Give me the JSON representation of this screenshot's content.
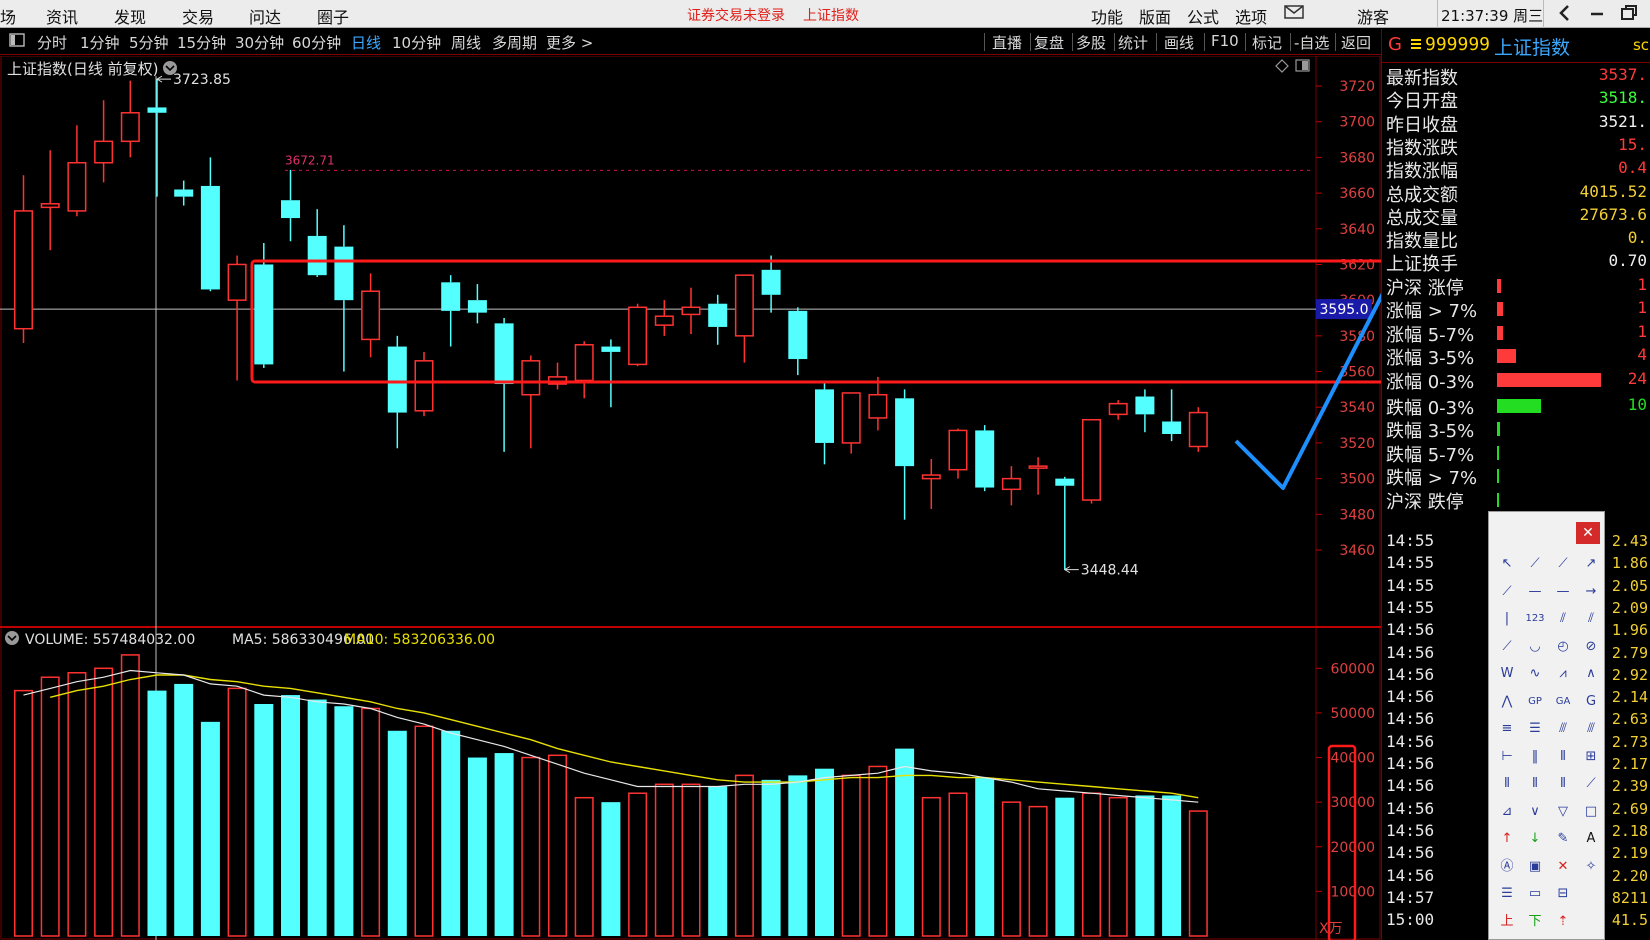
{
  "menubar": {
    "items": [
      "场",
      "资讯",
      "发现",
      "交易",
      "问达",
      "圈子"
    ],
    "warning": "证券交易未登录",
    "index_name": "上证指数",
    "right_items": [
      "功能",
      "版面",
      "公式",
      "选项"
    ],
    "mail_icon": "mail-icon",
    "guest": "游客",
    "clock": "21:37:39 周三",
    "window_buttons": [
      "back-icon",
      "minimize-icon",
      "restore-icon"
    ]
  },
  "periodbar": {
    "periods": [
      "分时",
      "1分钟",
      "5分钟",
      "15分钟",
      "30分钟",
      "60分钟",
      "日线",
      "10分钟",
      "周线",
      "多周期",
      "更多 >"
    ],
    "active": "日线",
    "tools": [
      "直播",
      "复盘",
      "多股",
      "统计",
      "画线",
      "F10",
      "标记",
      "-自选",
      "返回"
    ]
  },
  "chart_title": "上证指数(日线 前复权)",
  "volume_header": {
    "volume": "VOLUME: 557484032.00",
    "ma5": "MA5: 586330496.00",
    "ma10": "MA10: 583206336.00"
  },
  "colors": {
    "up": "#ff3232",
    "down": "#54ffff",
    "ma5": "#e8e8e8",
    "ma10": "#e8e000",
    "highlight": "#ff1a1a",
    "annotation_arrow": "#1e8fff",
    "crosshair_tag_bg": "#1a1aa8"
  },
  "chart_data": [
    {
      "type": "candlestick",
      "price_axis": {
        "ticks": [
          3720,
          3700,
          3680,
          3660,
          3640,
          3620,
          3600,
          3580,
          3560,
          3540,
          3520,
          3500,
          3480,
          3460
        ],
        "range": [
          3440,
          3740
        ]
      },
      "crosshair_price": "3595.0",
      "crosshair_candle_index": 5,
      "annotations": {
        "high": "3723.85",
        "low": "3448.44",
        "dashed_level": "3672.71"
      },
      "candles": [
        [
          3584,
          3650,
          3576,
          3670
        ],
        [
          3652,
          3654,
          3628,
          3684
        ],
        [
          3650,
          3677,
          3647,
          3698
        ],
        [
          3677,
          3689,
          3666,
          3712
        ],
        [
          3689,
          3705,
          3680,
          3723
        ],
        [
          3708,
          3705,
          3658,
          3723.85
        ],
        [
          3662,
          3658,
          3653,
          3667
        ],
        [
          3664,
          3606,
          3605,
          3680
        ],
        [
          3600,
          3620,
          3555,
          3625
        ],
        [
          3620,
          3564,
          3562,
          3632
        ],
        [
          3656,
          3646,
          3633,
          3673
        ],
        [
          3636,
          3614,
          3613,
          3651
        ],
        [
          3630,
          3600,
          3560,
          3642
        ],
        [
          3578,
          3605,
          3568,
          3615
        ],
        [
          3574,
          3537,
          3517,
          3580
        ],
        [
          3538,
          3566,
          3535,
          3571
        ],
        [
          3610,
          3594,
          3574,
          3614
        ],
        [
          3600,
          3593,
          3587,
          3609
        ],
        [
          3587,
          3553,
          3515,
          3590
        ],
        [
          3547,
          3566,
          3517,
          3569
        ],
        [
          3553,
          3557,
          3550,
          3565
        ],
        [
          3555,
          3575,
          3545,
          3577
        ],
        [
          3574,
          3571,
          3540,
          3578
        ],
        [
          3564,
          3596,
          3563,
          3598
        ],
        [
          3586,
          3591,
          3580,
          3600
        ],
        [
          3592,
          3596,
          3581,
          3607
        ],
        [
          3598,
          3585,
          3575,
          3603
        ],
        [
          3580,
          3614,
          3565,
          3614
        ],
        [
          3617,
          3603,
          3593,
          3625
        ],
        [
          3594,
          3567,
          3558,
          3596
        ],
        [
          3550,
          3520,
          3508,
          3554
        ],
        [
          3520,
          3548,
          3514,
          3548
        ],
        [
          3534,
          3547,
          3527,
          3557
        ],
        [
          3545,
          3507,
          3477,
          3550
        ],
        [
          3500,
          3502,
          3483,
          3511
        ],
        [
          3505,
          3527,
          3500,
          3528
        ],
        [
          3527,
          3495,
          3493,
          3530
        ],
        [
          3494,
          3500,
          3485,
          3507
        ],
        [
          3507,
          3507,
          3491,
          3512
        ],
        [
          3500,
          3496,
          3449,
          3501
        ],
        [
          3488,
          3533,
          3486,
          3533
        ],
        [
          3536,
          3542,
          3533,
          3544
        ],
        [
          3546,
          3536,
          3526,
          3550
        ],
        [
          3532,
          3525,
          3521,
          3550
        ],
        [
          3518,
          3537,
          3515,
          3540
        ]
      ]
    },
    {
      "type": "bar",
      "axis_ticks": [
        60000,
        50000,
        40000,
        30000,
        20000,
        10000
      ],
      "axis_unit": "X万",
      "range": [
        0,
        65000
      ],
      "volumes_wan": [
        55000,
        58000,
        59000,
        60000,
        63000,
        55000,
        56500,
        48000,
        55500,
        52000,
        54000,
        53000,
        51500,
        51000,
        46000,
        47000,
        46000,
        40000,
        41000,
        40000,
        40500,
        31000,
        30000,
        32000,
        34000,
        34000,
        33500,
        36000,
        35000,
        36000,
        37500,
        36000,
        38000,
        42000,
        31000,
        32000,
        35500,
        30000,
        29000,
        31000,
        32000,
        31000,
        31500,
        31500,
        28000
      ],
      "ma5_wan": [
        54000,
        55500,
        57000,
        58000,
        59500,
        59000,
        58500,
        56500,
        56000,
        54000,
        53500,
        52500,
        52000,
        51000,
        49000,
        47500,
        45500,
        44000,
        42500,
        40500,
        38500,
        36500,
        35000,
        33500,
        33500,
        33500,
        33500,
        34000,
        34000,
        34500,
        35500,
        36000,
        36500,
        38000,
        37000,
        36500,
        35500,
        34500,
        33000,
        32500,
        32000,
        31500,
        31000,
        30500,
        30000
      ],
      "ma10_wan": [
        null,
        53500,
        55000,
        56000,
        57500,
        58500,
        58500,
        57500,
        57000,
        56000,
        55500,
        54500,
        53500,
        52500,
        51000,
        50000,
        48500,
        47000,
        45500,
        44000,
        42000,
        40500,
        39000,
        38000,
        37000,
        36000,
        35000,
        34500,
        34500,
        34500,
        35000,
        35500,
        35500,
        36000,
        36000,
        35500,
        35500,
        35000,
        34500,
        34000,
        33500,
        33000,
        32500,
        32000,
        31000
      ]
    }
  ],
  "quote": {
    "flag": "G",
    "menu_icon": "list-icon",
    "code": "999999",
    "name": "上证指数",
    "right_label": "sc",
    "rows": [
      {
        "label": "最新指数",
        "value": "3537.",
        "color": "#ff3a3a"
      },
      {
        "label": "今日开盘",
        "value": "3518.",
        "color": "#3aff3a"
      },
      {
        "label": "昨日收盘",
        "value": "3521.",
        "color": "#f0f0f0"
      },
      {
        "label": "指数涨跌",
        "value": "15.",
        "color": "#ff3a3a"
      },
      {
        "label": "指数涨幅",
        "value": "0.4",
        "color": "#ff3a3a"
      },
      {
        "label": "总成交额",
        "value": "4015.52",
        "color": "#f2d034"
      },
      {
        "label": "总成交量",
        "value": "27673.6",
        "color": "#f2d034"
      },
      {
        "label": "指数量比",
        "value": "0.",
        "color": "#f2d034"
      },
      {
        "label": "上证换手",
        "value": "0.70",
        "color": "#f0f0f0"
      }
    ],
    "dist": [
      {
        "label": "沪深 涨停",
        "value": "1",
        "color": "#ff3a3a",
        "bar": 0.04
      },
      {
        "label": "涨幅 > 7%",
        "value": "1",
        "color": "#ff3a3a",
        "bar": 0.06
      },
      {
        "label": "涨幅 5-7%",
        "value": "1",
        "color": "#ff3a3a",
        "bar": 0.06
      },
      {
        "label": "涨幅 3-5%",
        "value": "4",
        "color": "#ff3a3a",
        "bar": 0.18
      },
      {
        "label": "涨幅 0-3%",
        "value": "24",
        "color": "#ff3a3a",
        "bar": 1.0
      },
      {
        "label": "跌幅 0-3%",
        "value": "10",
        "color": "#22dd22",
        "bar": 0.42
      },
      {
        "label": "跌幅 3-5%",
        "value": "",
        "color": "#22dd22",
        "bar": 0.03
      },
      {
        "label": "跌幅 5-7%",
        "value": "",
        "color": "#22dd22",
        "bar": 0.02
      },
      {
        "label": "跌幅 > 7%",
        "value": "",
        "color": "#22dd22",
        "bar": 0.02
      },
      {
        "label": "沪深 跌停",
        "value": "",
        "color": "#22dd22",
        "bar": 0
      }
    ],
    "ticks": [
      {
        "time": "14:55",
        "val": "2.43"
      },
      {
        "time": "14:55",
        "val": "1.86"
      },
      {
        "time": "14:55",
        "val": "2.05"
      },
      {
        "time": "14:55",
        "val": "2.09"
      },
      {
        "time": "14:56",
        "val": "1.96"
      },
      {
        "time": "14:56",
        "val": "2.79"
      },
      {
        "time": "14:56",
        "val": "2.92"
      },
      {
        "time": "14:56",
        "val": "2.14"
      },
      {
        "time": "14:56",
        "val": "2.63"
      },
      {
        "time": "14:56",
        "val": "2.73"
      },
      {
        "time": "14:56",
        "val": "2.17"
      },
      {
        "time": "14:56",
        "val": "2.39"
      },
      {
        "time": "14:56",
        "val": "2.69"
      },
      {
        "time": "14:56",
        "val": "2.18"
      },
      {
        "time": "14:56",
        "val": "2.19"
      },
      {
        "time": "14:56",
        "val": "2.20"
      },
      {
        "time": "14:57",
        "val": "8211"
      },
      {
        "time": "15:00",
        "val": "41.5"
      }
    ]
  },
  "palette": {
    "close_icon": "close-icon",
    "tools": [
      "cursor-icon",
      "line-segment-icon",
      "straight-line-icon",
      "ray-icon",
      "ray-down-icon",
      "horizontal-line-icon",
      "horizontal-segment-icon",
      "horizontal-ray-icon",
      "vertical-line-icon",
      "price-label-icon",
      "parallel-lines-icon",
      "channel-icon",
      "linear-regression-icon",
      "arc-icon",
      "circle-icon",
      "circle-line-icon",
      "wave-w-icon",
      "wave-m-icon",
      "trend-wave-icon",
      "zigzag-icon",
      "mountain-icon",
      "gp-icon",
      "ga-icon",
      "g-icon",
      "fib-retracement-icon",
      "gold-ratio-icon",
      "fan-lines-icon",
      "gann-fan-icon",
      "range-icon",
      "cycle-lines-icon",
      "fib-cycle-icon",
      "gann-icon",
      "barcode-icon",
      "barcode2-icon",
      "period-icon",
      "speed-lines-icon",
      "gann-box-icon",
      "down-arrow-line-icon",
      "triangle-icon",
      "rectangle-icon",
      "up-arrow-icon",
      "down-arrow-icon",
      "pen-icon",
      "text-a-icon",
      "text-style-icon",
      "fill-icon",
      "delete-icon",
      "magic-icon",
      "note-icon",
      "ruler-icon",
      "export-icon",
      "empty-slot",
      "up-mark-icon",
      "down-mark-icon",
      "level-mark-icon",
      "empty-slot2"
    ]
  }
}
